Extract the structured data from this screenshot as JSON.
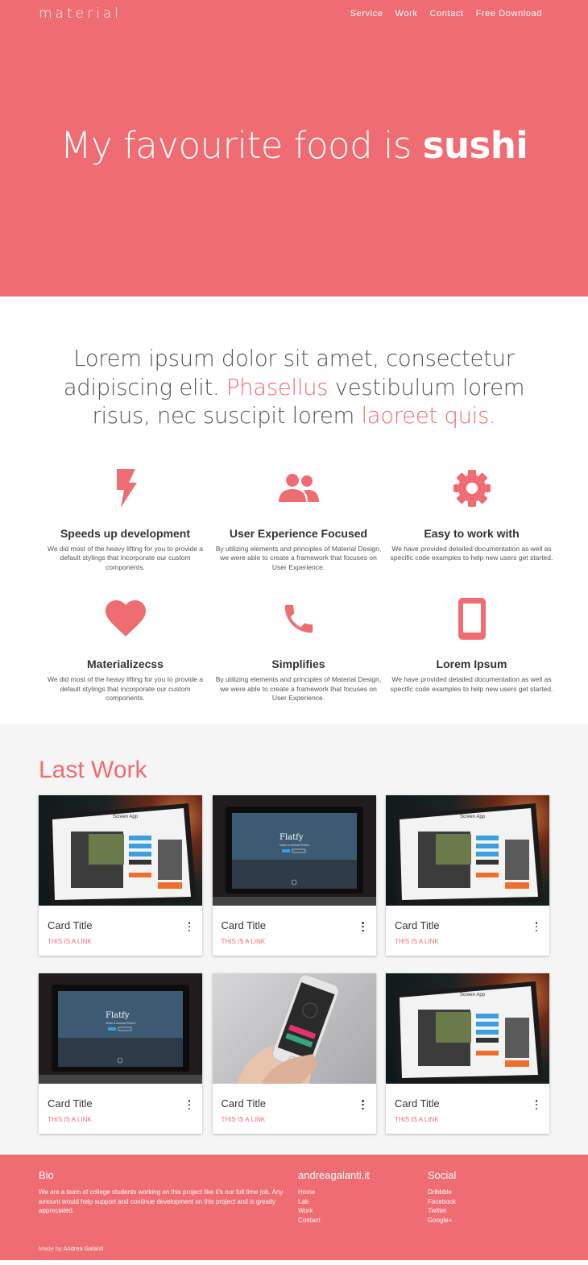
{
  "nav": {
    "logo": "material",
    "items": [
      "Service",
      "Work",
      "Contact",
      "Free Download"
    ]
  },
  "hero": {
    "title_light": "My favourite food is ",
    "title_bold": "sushi"
  },
  "intro": {
    "part1": "Lorem ipsum dolor sit amet, consectetur adipiscing elit. ",
    "hl1": "Phasellus",
    "part2": " vestibulum lorem risus, nec suscipit lorem ",
    "hl2": "laoreet quis."
  },
  "features": [
    {
      "icon": "flash-icon",
      "title": "Speeds up development",
      "desc": "We did most of the heavy lifting for you to provide a default stylings that incorporate our custom components."
    },
    {
      "icon": "group-icon",
      "title": "User Experience Focused",
      "desc": "By utilizing elements and principles of Material Design, we were able to create a framework that focuses on User Experience."
    },
    {
      "icon": "gear-icon",
      "title": "Easy to work with",
      "desc": "We have provided detailed documentation as well as specific code examples to help new users get started."
    },
    {
      "icon": "heart-icon",
      "title": "Materializecss",
      "desc": "We did most of the heavy lifting for you to provide a default stylings that incorporate our custom components."
    },
    {
      "icon": "phone-icon",
      "title": "Simplifies",
      "desc": "By utilizing elements and principles of Material Design, we were able to create a framework that focuses on User Experience."
    },
    {
      "icon": "tablet-icon",
      "title": "Lorem Ipsum",
      "desc": "We have provided detailed documentation as well as specific code examples to help new users get started."
    }
  ],
  "work": {
    "title": "Last Work",
    "cards": [
      {
        "image": "laptop-screen-app",
        "screen_title": "Screen App",
        "title": "Card Title",
        "link": "THIS IS A LINK"
      },
      {
        "image": "laptop-flatfy",
        "screen_title": "Flatfy",
        "screen_sub": "Clean & minimal Theme",
        "title": "Card Title",
        "link": "THIS IS A LINK"
      },
      {
        "image": "laptop-screen-app",
        "screen_title": "Screen App",
        "title": "Card Title",
        "link": "THIS IS A LINK"
      },
      {
        "image": "laptop-flatfy",
        "screen_title": "Flatfy",
        "screen_sub": "Clean & minimal Theme",
        "title": "Card Title",
        "link": "THIS IS A LINK"
      },
      {
        "image": "phone-in-hand",
        "title": "Card Title",
        "link": "THIS IS A LINK"
      },
      {
        "image": "laptop-screen-app",
        "screen_title": "Screen App",
        "title": "Card Title",
        "link": "THIS IS A LINK"
      }
    ]
  },
  "footer": {
    "bio_title": "Bio",
    "bio_text": "We are a team of college students working on this project like it's our full time job. Any amount would help support and continue development on this project and is greatly appreciated.",
    "site_title": "andreagalanti.it",
    "site_links": [
      "Home",
      "Lab",
      "Work",
      "Contact"
    ],
    "social_title": "Social",
    "social_links": [
      "Dribbble",
      "Facebook",
      "Twitter",
      "Google+"
    ],
    "made_by_prefix": "Made by ",
    "made_by_name": "Andrea Galanti"
  },
  "colors": {
    "accent": "#ef6c72",
    "work_bg": "#f5f5f5"
  }
}
